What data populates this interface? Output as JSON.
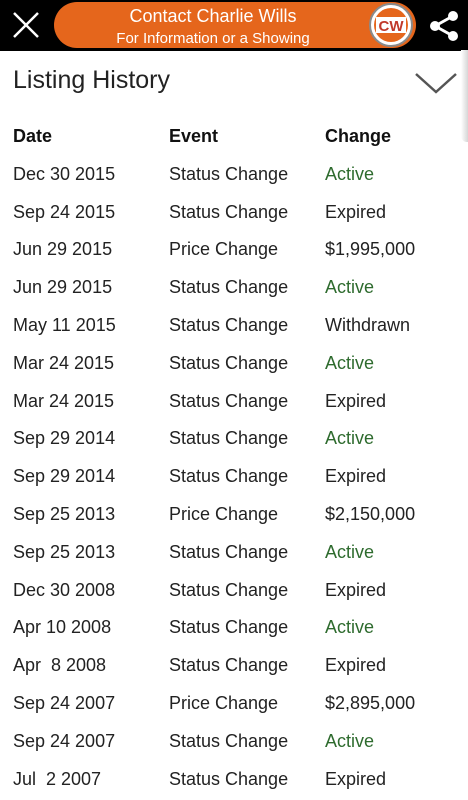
{
  "topbar": {
    "contact_title": "Contact Charlie Wills",
    "contact_subtitle": "For Information or a Showing",
    "logo_text": "CW",
    "accent_color": "#e5661c"
  },
  "panel": {
    "title": "Listing History"
  },
  "history": {
    "headers": [
      "Date",
      "Event",
      "Change"
    ],
    "rows": [
      {
        "date": "Dec 30 2015",
        "event": "Status Change",
        "change": "Active"
      },
      {
        "date": "Sep 24 2015",
        "event": "Status Change",
        "change": "Expired"
      },
      {
        "date": "Jun 29 2015",
        "event": "Price Change",
        "change": "$1,995,000"
      },
      {
        "date": "Jun 29 2015",
        "event": "Status Change",
        "change": "Active"
      },
      {
        "date": "May 11 2015",
        "event": "Status Change",
        "change": "Withdrawn"
      },
      {
        "date": "Mar 24 2015",
        "event": "Status Change",
        "change": "Active"
      },
      {
        "date": "Mar 24 2015",
        "event": "Status Change",
        "change": "Expired"
      },
      {
        "date": "Sep 29 2014",
        "event": "Status Change",
        "change": "Active"
      },
      {
        "date": "Sep 29 2014",
        "event": "Status Change",
        "change": "Expired"
      },
      {
        "date": "Sep 25 2013",
        "event": "Price Change",
        "change": "$2,150,000"
      },
      {
        "date": "Sep 25 2013",
        "event": "Status Change",
        "change": "Active"
      },
      {
        "date": "Dec 30 2008",
        "event": "Status Change",
        "change": "Expired"
      },
      {
        "date": "Apr 10 2008",
        "event": "Status Change",
        "change": "Active"
      },
      {
        "date": "Apr  8 2008",
        "event": "Status Change",
        "change": "Expired"
      },
      {
        "date": "Sep 24 2007",
        "event": "Price Change",
        "change": "$2,895,000"
      },
      {
        "date": "Sep 24 2007",
        "event": "Status Change",
        "change": "Active"
      },
      {
        "date": "Jul  2 2007",
        "event": "Status Change",
        "change": "Expired"
      }
    ],
    "active_color": "#2e6b2e"
  }
}
